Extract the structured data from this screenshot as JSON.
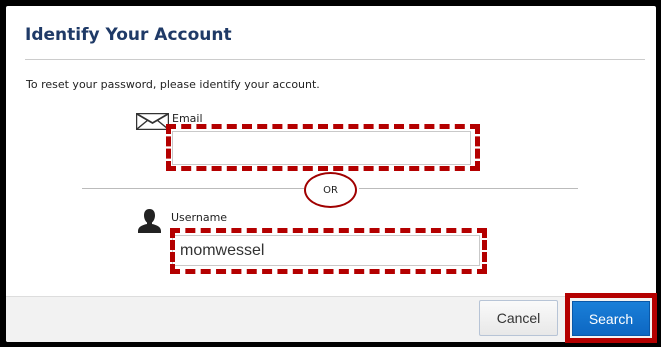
{
  "dialog": {
    "title": "Identify Your Account",
    "instructions": "To reset your password, please identify your account."
  },
  "email": {
    "label": "Email",
    "value": "",
    "icon": "envelope-icon"
  },
  "separator": {
    "text": "OR"
  },
  "username": {
    "label": "Username",
    "value": "momwessel",
    "icon": "user-icon"
  },
  "buttons": {
    "cancel_label": "Cancel",
    "search_label": "Search"
  },
  "colors": {
    "title": "#1f3a67",
    "highlight": "#b40000",
    "search_button": "#1372cf",
    "footer_bg": "#f2f2f2"
  }
}
